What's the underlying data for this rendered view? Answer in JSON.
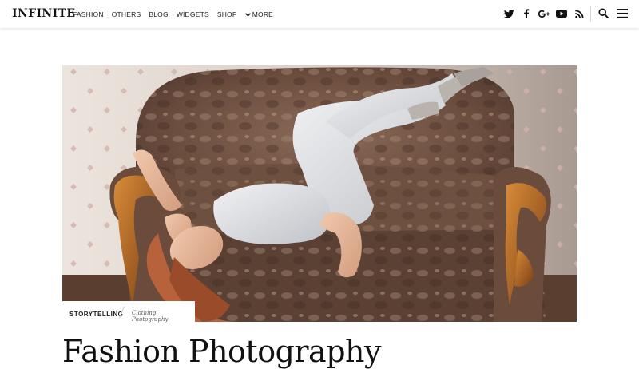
{
  "header": {
    "logo": "INFINITE",
    "nav": [
      "FASHION",
      "OTHERS",
      "BLOG",
      "WIDGETS",
      "SHOP"
    ],
    "more_label": "MORE",
    "social_icons": [
      "twitter-icon",
      "facebook-icon",
      "google-plus-icon",
      "youtube-icon",
      "rss-icon"
    ]
  },
  "post": {
    "category": "STORYTELLING",
    "tags": "Clothing, Photography",
    "title": "Fashion Photography"
  },
  "colors": {
    "text": "#111111",
    "header_bg": "#ffffff",
    "sofa": "#6b4d3c"
  }
}
